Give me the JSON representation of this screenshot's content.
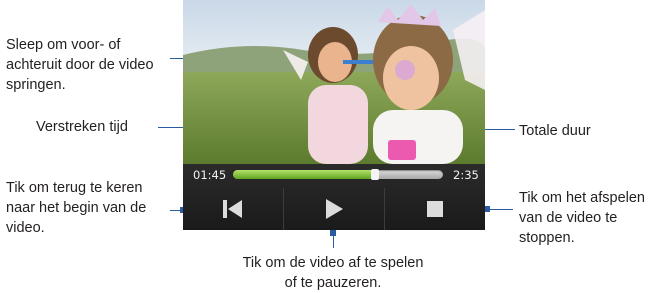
{
  "callouts": {
    "seek": "Sleep om voor- of achteruit door de video springen.",
    "elapsed": "Verstreken tijd",
    "total": "Totale duur",
    "restart": "Tik om terug te keren naar het begin van de video.",
    "stop": "Tik om het afspelen van de video te stoppen.",
    "playpause": "Tik om de video af te spelen of te pauzeren."
  },
  "player": {
    "elapsed_time": "01:45",
    "total_time": "2:35",
    "progress_fraction": 0.677
  },
  "icons": {
    "restart": "skip-to-start-icon",
    "play": "play-icon",
    "stop": "stop-icon"
  },
  "colors": {
    "callout_line": "#2a5aa0",
    "progress_green": "#6db82a"
  }
}
